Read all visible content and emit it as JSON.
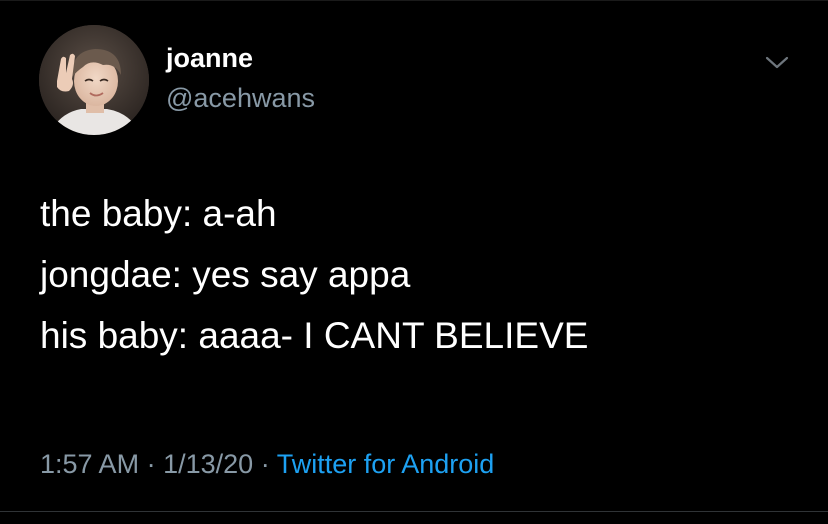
{
  "author": {
    "display_name": "joanne",
    "handle": "@acehwans"
  },
  "tweet": {
    "lines": [
      "the baby: a-ah",
      "jongdae: yes say appa",
      "his baby: aaaa- I CANT BELIEVE"
    ]
  },
  "meta": {
    "time": "1:57 AM",
    "separator": "·",
    "date": "1/13/20",
    "source": "Twitter for Android"
  },
  "icons": {
    "more_menu": "chevron-down-icon"
  },
  "colors": {
    "background": "#000000",
    "text_primary": "#ffffff",
    "text_secondary": "#8899a6",
    "link": "#1da1f2"
  }
}
